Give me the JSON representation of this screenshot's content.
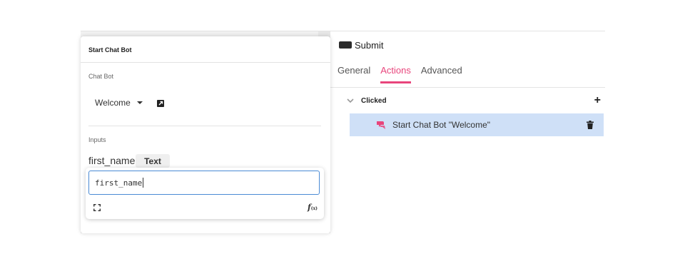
{
  "widget": {
    "label": "Submit"
  },
  "tabs": [
    {
      "label": "General",
      "active": false
    },
    {
      "label": "Actions",
      "active": true
    },
    {
      "label": "Advanced",
      "active": false
    }
  ],
  "event": {
    "label": "Clicked"
  },
  "action": {
    "label": "Start Chat Bot \"Welcome\""
  },
  "panel": {
    "title": "Start Chat Bot",
    "chat_bot_label": "Chat Bot",
    "chat_bot_value": "Welcome",
    "inputs_label": "Inputs",
    "input": {
      "name": "first_name",
      "type": "Text",
      "value": "first_name"
    }
  },
  "colors": {
    "accent": "#e8457c",
    "selection": "#cfe0f7",
    "focus": "#4a8ad4"
  }
}
